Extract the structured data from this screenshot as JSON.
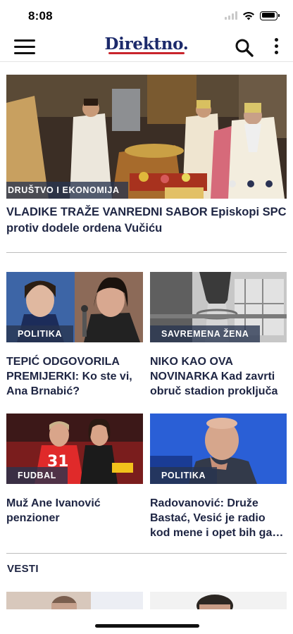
{
  "status_bar": {
    "time": "8:08"
  },
  "header": {
    "logo_text": "Direktno.",
    "menu_icon": "hamburger-menu-icon",
    "search_icon": "search-icon",
    "more_icon": "more-vertical-icon"
  },
  "hero": {
    "category": "DRUŠTVO I EKONOMIJA",
    "headline": "VLADIKE TRAŽE VANREDNI SABOR Episkopi SPC protiv dodele ordena Vučiću",
    "slides": 3,
    "active_slide": 1
  },
  "articles": [
    {
      "category": "POLITIKA",
      "title": "TEPIĆ ODGOVORILA PREMIJERKI: Ko ste vi, Ana Brnabić?"
    },
    {
      "category": "SAVREMENA ŽENA",
      "title": " NIKO KAO OVA NOVINARKA Kad zavrti obruč stadion proključa"
    },
    {
      "category": "FUDBAL",
      "title": "Muž Ane Ivanović penzioner"
    },
    {
      "category": "POLITIKA",
      "title": "Radovanović: Druže Bastać, Vesić je radio kod mene i opet bih ga zapo…"
    }
  ],
  "sections": {
    "news_title": "VESTI"
  },
  "colors": {
    "brand_blue": "#1c2a6b",
    "brand_red": "#c9252c",
    "tag_background": "#283450",
    "headline_text": "#1e2543"
  }
}
